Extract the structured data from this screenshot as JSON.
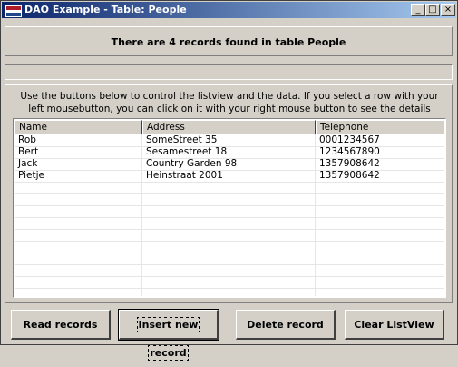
{
  "window": {
    "title": "DAO Example - Table: People",
    "controls": {
      "minimize": "_",
      "maximize": "□",
      "close": "×"
    }
  },
  "header": {
    "status": "There are 4 records found in table People"
  },
  "progress": {
    "value": 0
  },
  "instructions": "Use the buttons below to control the listview and the data. If you select a row with your left mousebutton, you can click on it with your right mouse button to see the details",
  "listview": {
    "columns": [
      "Name",
      "Address",
      "Telephone"
    ],
    "rows": [
      [
        "Rob",
        "SomeStreet 35",
        "0001234567"
      ],
      [
        "Bert",
        "Sesamestreet 18",
        "1234567890"
      ],
      [
        "Jack",
        "Country Garden 98",
        "1357908642"
      ],
      [
        "Pietje",
        "Heinstraat 2001",
        "1357908642"
      ]
    ]
  },
  "buttons": {
    "read": "Read records",
    "insert": "Insert new record",
    "delete": "Delete record",
    "clear": "Clear ListView"
  },
  "colors": {
    "titlebar_start": "#0a246a",
    "titlebar_end": "#a6caf0",
    "face": "#d4d0c8"
  }
}
